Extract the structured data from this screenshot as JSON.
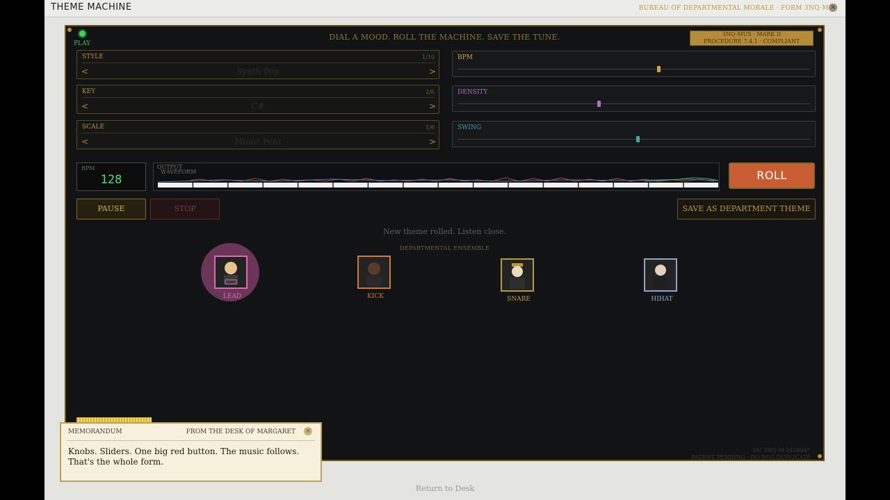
{
  "window": {
    "title": "THEME MACHINE",
    "form_ref": "BUREAU OF DEPARTMENTAL MORALE · FORM 3NQ-M"
  },
  "console": {
    "play_label": "PLAY",
    "tagline": "DIAL A MOOD. ROLL THE MACHINE. SAVE THE TUNE.",
    "plate_line1": "3NQ-MUS · MARK II",
    "plate_line2": "PROCEDURE 7.4.1 · COMPLIANT"
  },
  "selectors": [
    {
      "label": "STYLE",
      "count": "1/10",
      "value": "Synth Pop"
    },
    {
      "label": "KEY",
      "count": "2/6",
      "value": "C#"
    },
    {
      "label": "SCALE",
      "count": "1/6",
      "value": "Minor Pent"
    }
  ],
  "arrows": {
    "prev": "<",
    "next": ">"
  },
  "sliders": [
    {
      "label": "BPM",
      "level": 0.57,
      "color": "#d9a43a"
    },
    {
      "label": "DENSITY",
      "level": 0.4,
      "color": "#b06fc2"
    },
    {
      "label": "SWING",
      "level": 0.51,
      "color": "#3fa7a9"
    }
  ],
  "bpm_display": {
    "label": "BPM",
    "value": "128"
  },
  "output": {
    "label": "OUTPUT",
    "waveform_label": "WAVEFORM"
  },
  "buttons": {
    "roll": "ROLL",
    "pause": "PAUSE",
    "stop": "STOP",
    "save": "SAVE AS DEPARTMENT THEME"
  },
  "status": "New theme rolled. Listen close.",
  "ensemble_title": "DEPARTMENTAL ENSEMBLE",
  "ensemble": [
    {
      "label": "LEAD",
      "color": "#d46fb0",
      "active": true
    },
    {
      "label": "KICK",
      "color": "#d0783f",
      "active": false
    },
    {
      "label": "SNARE",
      "color": "#b89a3c",
      "active": false
    },
    {
      "label": "HIHAT",
      "color": "#8fa6c8",
      "active": false
    }
  ],
  "memo": {
    "heading": "MEMORANDUM",
    "from": "FROM THE DESK OF MARGARET",
    "body": "Knobs. Sliders. One big red button. The music follows. That's the whole form."
  },
  "serial": {
    "line1": "SN 3NQ-M-2438047",
    "line2": "PATENT PENDING · DO NOT DUPLICATE"
  },
  "footer": {
    "return_label": "Return to Desk"
  }
}
